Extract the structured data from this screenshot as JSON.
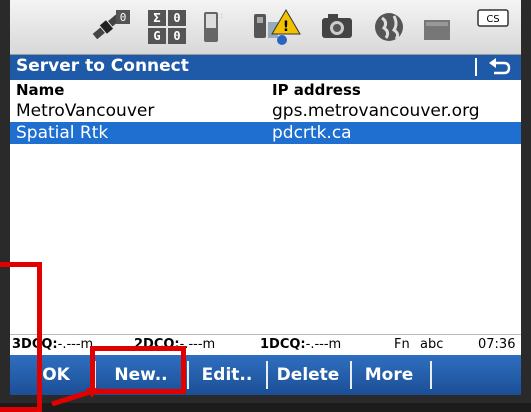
{
  "status_bar": {
    "position_quality": {
      "top_left": "Σ",
      "top_right": "0",
      "bottom_left": "G",
      "bottom_right": "0"
    },
    "satellites_count": "0",
    "icons": [
      "satellite-icon",
      "position-cells-icon",
      "battery-icon",
      "connection-warning-icon",
      "camera-icon",
      "globe-icon",
      "memory-icon",
      "cs-card-icon"
    ],
    "card_label": "CS"
  },
  "title_bar": {
    "title": "Server to Connect",
    "back_icon": "return-arrow-icon"
  },
  "table": {
    "headers": {
      "name": "Name",
      "ip": "IP address"
    },
    "rows": [
      {
        "name": "MetroVancouver",
        "ip": "gps.metrovancouver.org",
        "selected": false
      },
      {
        "name": "Spatial Rtk",
        "ip": "pdcrtk.ca",
        "selected": true
      }
    ]
  },
  "dcq": {
    "three_d_label": "3DCQ:",
    "three_d_value": "-.---m",
    "two_d_label": "2DCQ:",
    "two_d_value": "-.---m",
    "one_d_label": "1DCQ:",
    "one_d_value": "-.---m",
    "fn": "Fn",
    "input_mode": "abc",
    "time": "07:36"
  },
  "softkeys": {
    "ok": "OK",
    "new": "New..",
    "edit": "Edit..",
    "delete": "Delete",
    "more": "More"
  },
  "colors": {
    "accent": "#1f5aa8",
    "selection": "#1e6fd0",
    "annotation": "#e00000"
  }
}
